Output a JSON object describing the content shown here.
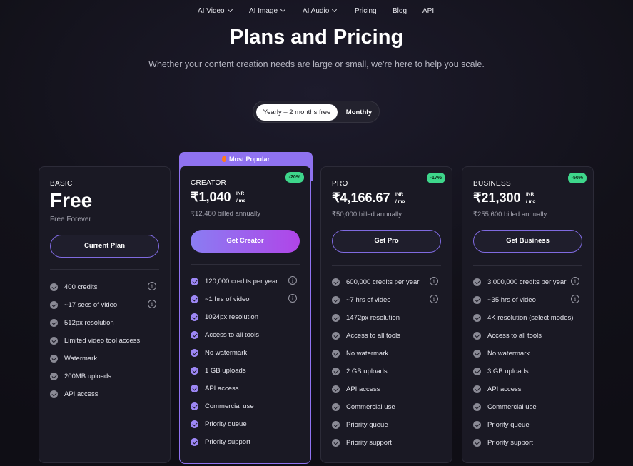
{
  "nav": {
    "items": [
      {
        "label": "AI Video",
        "dropdown": true
      },
      {
        "label": "AI Image",
        "dropdown": true
      },
      {
        "label": "AI Audio",
        "dropdown": true
      },
      {
        "label": "Pricing",
        "dropdown": false
      },
      {
        "label": "Blog",
        "dropdown": false
      },
      {
        "label": "API",
        "dropdown": false
      }
    ]
  },
  "header": {
    "title": "Plans and Pricing",
    "subtitle": "Whether your content creation needs are large or small, we're here to help you scale."
  },
  "billing_toggle": {
    "yearly_label": "Yearly – 2 months free",
    "monthly_label": "Monthly",
    "selected": "yearly"
  },
  "popular_label": "Most Popular",
  "colors": {
    "accent": "#8f72f0",
    "badge": "#3ed68b",
    "background": "#121119",
    "card": "#1a1924"
  },
  "plans": [
    {
      "name": "BASIC",
      "price": "Free",
      "price_sub": "Free Forever",
      "button": "Current Plan",
      "features": [
        {
          "text": "400 credits",
          "info": true
        },
        {
          "text": "~17 secs of video",
          "info": true
        },
        {
          "text": "512px resolution",
          "info": false
        },
        {
          "text": "Limited video tool access",
          "info": false
        },
        {
          "text": "Watermark",
          "info": false
        },
        {
          "text": "200MB uploads",
          "info": false
        },
        {
          "text": "API access",
          "info": false
        }
      ]
    },
    {
      "name": "CREATOR",
      "price": "₹1,040",
      "currency": "INR",
      "per": "/ mo",
      "billed": "₹12,480 billed annually",
      "badge": "-20%",
      "button": "Get Creator",
      "features": [
        {
          "text": "120,000 credits per year",
          "info": true
        },
        {
          "text": "~1 hrs of video",
          "info": true
        },
        {
          "text": "1024px resolution",
          "info": false
        },
        {
          "text": "Access to all tools",
          "info": false
        },
        {
          "text": "No watermark",
          "info": false
        },
        {
          "text": "1 GB uploads",
          "info": false
        },
        {
          "text": "API access",
          "info": false
        },
        {
          "text": "Commercial use",
          "info": false
        },
        {
          "text": "Priority queue",
          "info": false
        },
        {
          "text": "Priority support",
          "info": false
        }
      ]
    },
    {
      "name": "PRO",
      "price": "₹4,166.67",
      "currency": "INR",
      "per": "/ mo",
      "billed": "₹50,000 billed annually",
      "badge": "-17%",
      "button": "Get Pro",
      "features": [
        {
          "text": "600,000 credits per year",
          "info": true
        },
        {
          "text": "~7 hrs of video",
          "info": true
        },
        {
          "text": "1472px resolution",
          "info": false
        },
        {
          "text": "Access to all tools",
          "info": false
        },
        {
          "text": "No watermark",
          "info": false
        },
        {
          "text": "2 GB uploads",
          "info": false
        },
        {
          "text": "API access",
          "info": false
        },
        {
          "text": "Commercial use",
          "info": false
        },
        {
          "text": "Priority queue",
          "info": false
        },
        {
          "text": "Priority support",
          "info": false
        }
      ]
    },
    {
      "name": "BUSINESS",
      "price": "₹21,300",
      "currency": "INR",
      "per": "/ mo",
      "billed": "₹255,600 billed annually",
      "badge": "-50%",
      "button": "Get Business",
      "features": [
        {
          "text": "3,000,000 credits per year",
          "info": true
        },
        {
          "text": "~35 hrs of video",
          "info": true
        },
        {
          "text": "4K resolution (select modes)",
          "info": false
        },
        {
          "text": "Access to all tools",
          "info": false
        },
        {
          "text": "No watermark",
          "info": false
        },
        {
          "text": "3 GB uploads",
          "info": false
        },
        {
          "text": "API access",
          "info": false
        },
        {
          "text": "Commercial use",
          "info": false
        },
        {
          "text": "Priority queue",
          "info": false
        },
        {
          "text": "Priority support",
          "info": false
        }
      ]
    }
  ]
}
